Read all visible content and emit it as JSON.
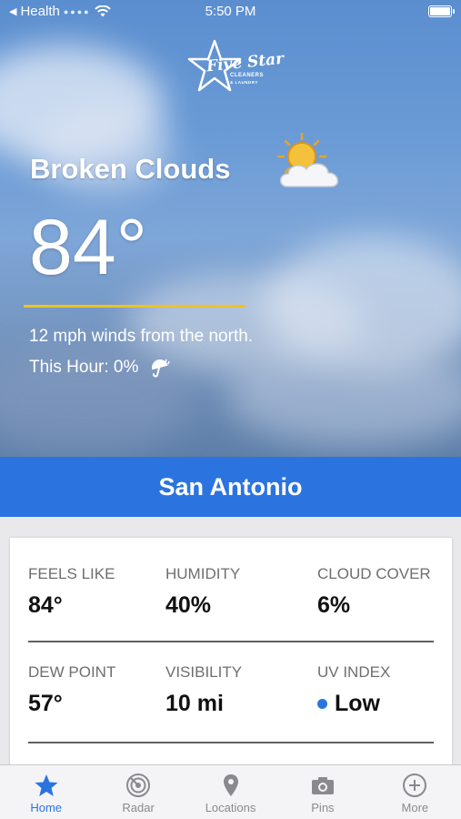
{
  "status_bar": {
    "back_app": "Health",
    "time": "5:50 PM"
  },
  "brand": {
    "name": "Five Star",
    "tagline_1": "CLEANERS",
    "tagline_2": "& LAUNDRY"
  },
  "current": {
    "condition": "Broken Clouds",
    "condition_icon": "sun-behind-cloud-icon",
    "temperature": "84°",
    "wind": "12 mph winds from the north.",
    "precip": "This Hour: 0%",
    "precip_icon": "umbrella-rain-icon"
  },
  "location": {
    "name": "San Antonio"
  },
  "metrics": [
    {
      "label": "FEELS LIKE",
      "value": "84°"
    },
    {
      "label": "HUMIDITY",
      "value": "40%"
    },
    {
      "label": "CLOUD COVER",
      "value": "6%"
    },
    {
      "label": "DEW POINT",
      "value": "57°"
    },
    {
      "label": "VISIBILITY",
      "value": "10 mi"
    },
    {
      "label": "UV INDEX",
      "value": "Low"
    }
  ],
  "colors": {
    "accent": "#2b74e0",
    "highlight": "#f2c21b"
  },
  "tabs": [
    {
      "label": "Home",
      "icon": "star-icon",
      "active": true
    },
    {
      "label": "Radar",
      "icon": "radar-icon",
      "active": false
    },
    {
      "label": "Locations",
      "icon": "location-pin-icon",
      "active": false
    },
    {
      "label": "Pins",
      "icon": "camera-icon",
      "active": false
    },
    {
      "label": "More",
      "icon": "plus-circle-icon",
      "active": false
    }
  ]
}
